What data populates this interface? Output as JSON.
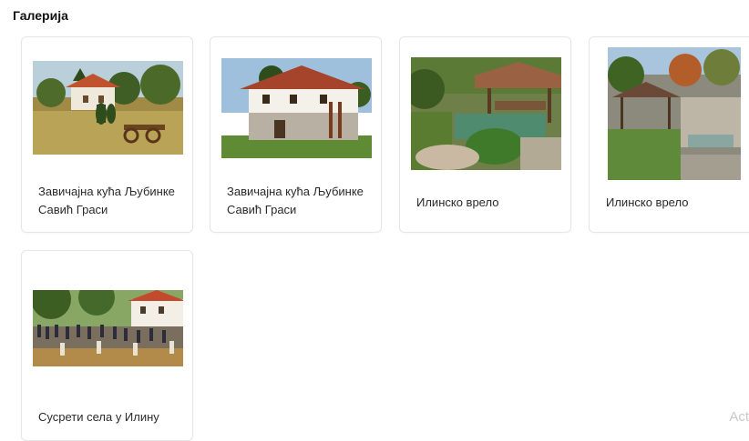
{
  "gallery": {
    "title": "Галерија",
    "items": [
      {
        "caption": "Завичајна кућа Љубинке Савић Граси",
        "image": "house-photo"
      },
      {
        "caption": "Завичајна кућа Љубинке Савић Граси",
        "image": "house-photo"
      },
      {
        "caption": "Илинско врело",
        "image": "spring-gazebo-photo"
      },
      {
        "caption": "Илинско врело",
        "image": "spring-gazebo-photo"
      },
      {
        "caption": "Сусрети села у Илину",
        "image": "village-gathering-photo"
      }
    ]
  },
  "watermark": "Act"
}
